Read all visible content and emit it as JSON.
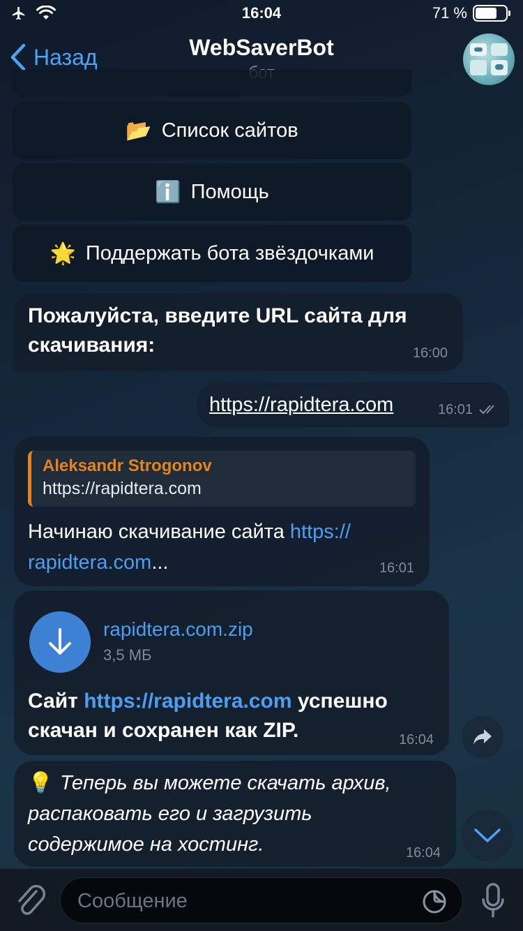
{
  "status_bar": {
    "time": "16:04",
    "battery_percent": "71 %",
    "battery_level": 0.71
  },
  "header": {
    "back_label": "Назад",
    "title": "WebSaverBot",
    "subtitle": "бот"
  },
  "keyboard": [
    {
      "icon": "folder-icon",
      "emoji": "📂",
      "label": "Список сайтов"
    },
    {
      "icon": "info-icon",
      "emoji": "ℹ️",
      "label": "Помощь"
    },
    {
      "icon": "star-icon",
      "emoji": "🌟",
      "label": "Поддержать бота звёздочками"
    }
  ],
  "messages": {
    "m1": {
      "line1": "Пожалуйста, введите URL сайта для",
      "line2": "скачивания:",
      "time": "16:00"
    },
    "m2": {
      "link": "https://rapidtera.com",
      "time": "16:01"
    },
    "m3": {
      "reply_author": "Aleksandr Strogonov",
      "reply_text": "https://rapidtera.com",
      "text_start": "Начинаю скачивание сайта ",
      "link_part1": "https://",
      "link_part2": "rapidtera.com",
      "text_end": "...",
      "time": "16:01"
    },
    "m4": {
      "file_name": "rapidtera.com.zip",
      "file_size": "3,5 МБ",
      "text_start": "Сайт ",
      "link": "https://rapidtera.com",
      "text_mid": " успешно",
      "line2": "скачан и сохранен как ZIP.",
      "time": "16:04"
    },
    "m5": {
      "emoji": "💡",
      "line1": "Теперь вы можете скачать архив,",
      "line2": "распаковать его и загрузить",
      "line3": "содержимое на хостинг.",
      "time": "16:04"
    }
  },
  "input": {
    "placeholder": "Сообщение"
  }
}
